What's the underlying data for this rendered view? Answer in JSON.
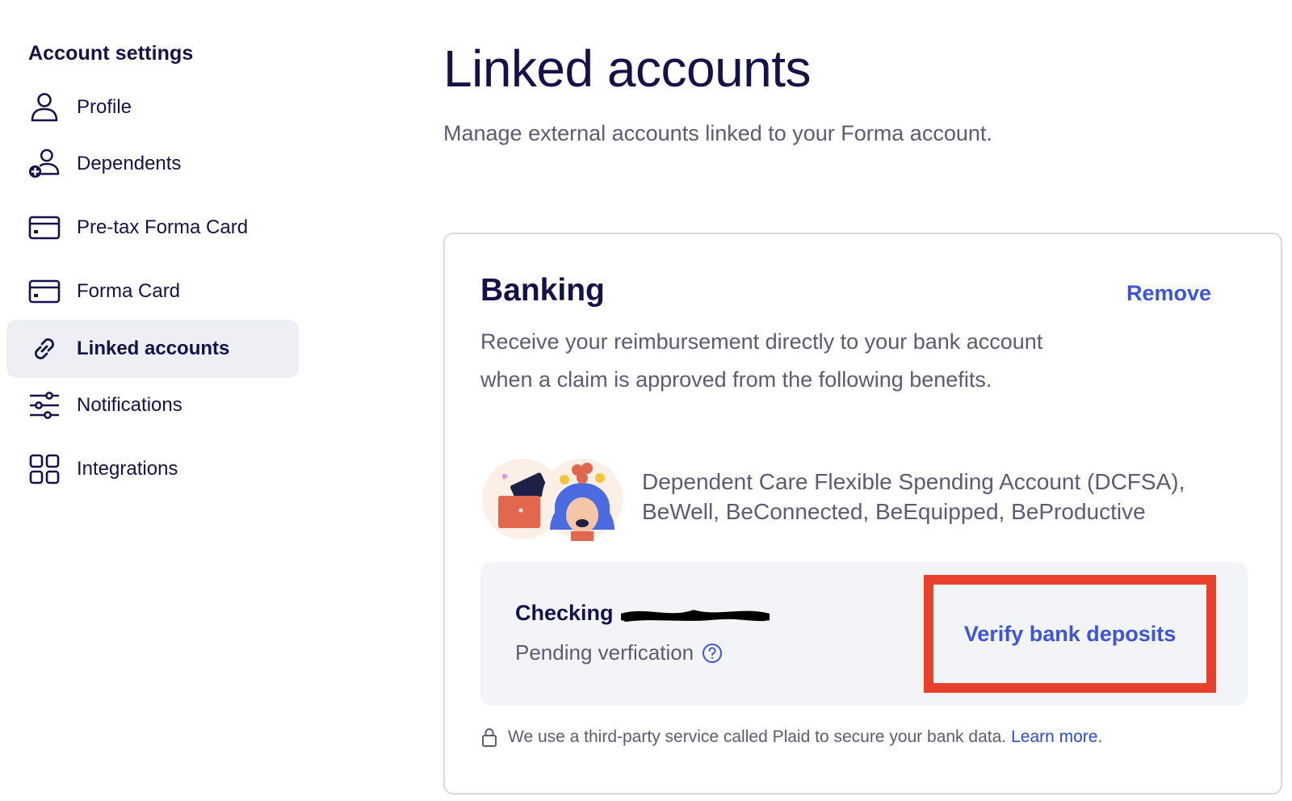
{
  "sidebar": {
    "heading": "Account settings",
    "items": [
      {
        "label": "Profile",
        "icon": "user-icon"
      },
      {
        "label": "Dependents",
        "icon": "add-person-icon"
      },
      {
        "label": "Pre-tax Forma Card",
        "icon": "card-icon"
      },
      {
        "label": "Forma Card",
        "icon": "card-icon"
      },
      {
        "label": "Linked accounts",
        "icon": "link-icon",
        "active": true
      },
      {
        "label": "Notifications",
        "icon": "sliders-icon"
      },
      {
        "label": "Integrations",
        "icon": "grid-icon"
      }
    ]
  },
  "main": {
    "title": "Linked accounts",
    "subtitle": "Manage external accounts linked to your Forma account."
  },
  "banking": {
    "title": "Banking",
    "remove_label": "Remove",
    "description": "Receive your reimbursement directly to your bank account when a claim is approved from the following benefits.",
    "benefits_text": "Dependent Care Flexible Spending Account (DCFSA), BeWell, BeConnected, BeEquipped, BeProductive",
    "account": {
      "name": "Checking",
      "status": "Pending verfication",
      "verify_label": "Verify bank deposits"
    },
    "footer": {
      "text": "We use a third-party service called Plaid to secure your bank data.",
      "link_label": "Learn more",
      "trailing": "."
    }
  },
  "colors": {
    "navy": "#15124a",
    "accent_blue": "#3d55d8",
    "highlight_red": "#e8402b",
    "active_bg": "#eeeff4",
    "panel_bg": "#f3f4f7"
  }
}
